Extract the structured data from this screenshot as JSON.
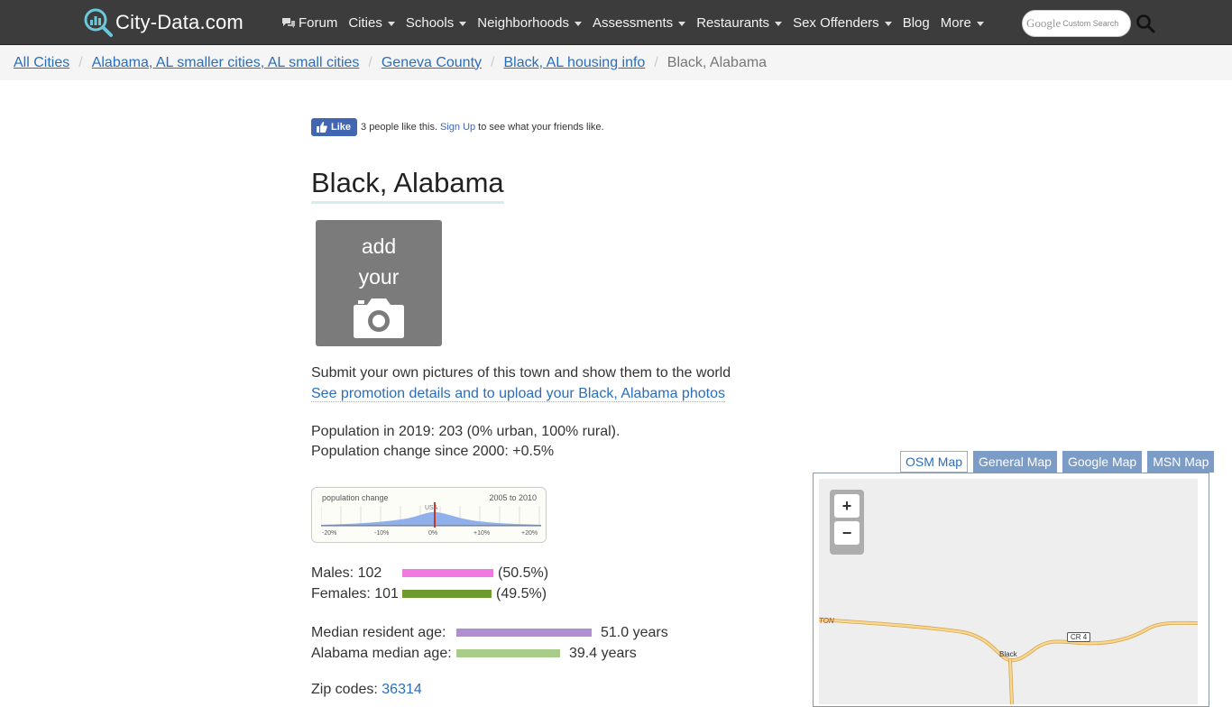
{
  "nav": {
    "logo": "City-Data.com",
    "items": [
      {
        "label": "Forum",
        "caret": false,
        "icon": "chat-icon"
      },
      {
        "label": "Cities",
        "caret": true
      },
      {
        "label": "Schools",
        "caret": true
      },
      {
        "label": "Neighborhoods",
        "caret": true
      },
      {
        "label": "Assessments",
        "caret": true
      },
      {
        "label": "Restaurants",
        "caret": true
      },
      {
        "label": "Sex Offenders",
        "caret": true
      },
      {
        "label": "Blog",
        "caret": false
      },
      {
        "label": "More",
        "caret": true
      }
    ],
    "search_brand": "Google",
    "search_placeholder": "Custom Search"
  },
  "breadcrumb": {
    "items": [
      "All Cities",
      "Alabama, AL smaller cities, AL small cities",
      "Geneva County",
      "Black, AL housing info"
    ],
    "current": "Black, Alabama"
  },
  "like": {
    "button": "Like",
    "text_before": "3 people like this.",
    "sign_up": "Sign Up",
    "text_after": "to see what your friends like."
  },
  "title": "Black, Alabama",
  "photo": {
    "line1": "add",
    "line2": "your"
  },
  "submit_text": "Submit your own pictures of this town and show them to the world",
  "promo_link": "See promotion details and to upload your Black, Alabama photos",
  "population": {
    "line1": "Population in 2019: 203 (0% urban, 100% rural).",
    "line2": "Population change since 2000: +0.5%"
  },
  "pop_chart": {
    "label": "population change",
    "range": "2005 to 2010",
    "marker": "USA",
    "ticks": [
      "-20%",
      "-10%",
      "0%",
      "+10%",
      "+20%"
    ]
  },
  "gender": {
    "males_label": "Males: 102",
    "males_pct": "(50.5%)",
    "males_fraction": 0.505,
    "females_label": "Females: 101",
    "females_pct": "(49.5%)",
    "females_fraction": 0.495,
    "male_color": "#f07ae0",
    "female_color": "#6e9a2e"
  },
  "age": {
    "resident_label": "Median resident age:",
    "resident_value": "51.0 years",
    "state_label": "Alabama median age:",
    "state_value": "39.4 years",
    "resident_color": "#b08fd0",
    "state_color": "#a9cc8a"
  },
  "zip": {
    "label": "Zip codes:",
    "code": "36314"
  },
  "map": {
    "tabs": [
      "OSM Map",
      "General Map",
      "Google Map",
      "MSN Map"
    ],
    "active": "OSM Map",
    "zoom_in": "+",
    "zoom_out": "−",
    "labels": {
      "town": "Black",
      "road": "CR 4",
      "partial": "TON"
    }
  }
}
